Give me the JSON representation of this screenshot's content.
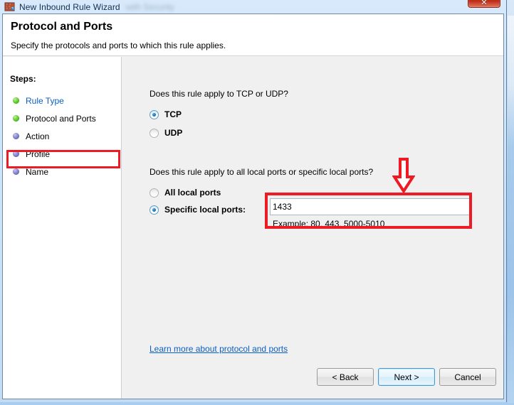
{
  "window": {
    "title": "New Inbound Rule Wizard",
    "title_blurred": "with Security",
    "icon": "firewall-icon",
    "close_label": "✕"
  },
  "header": {
    "title": "Protocol and Ports",
    "subtitle": "Specify the protocols and ports to which this rule applies."
  },
  "sidebar": {
    "steps_label": "Steps:",
    "items": [
      {
        "label": "Rule Type",
        "state": "done",
        "link": true
      },
      {
        "label": "Protocol and Ports",
        "state": "current",
        "link": false
      },
      {
        "label": "Action",
        "state": "todo",
        "link": false
      },
      {
        "label": "Profile",
        "state": "todo",
        "link": false
      },
      {
        "label": "Name",
        "state": "todo",
        "link": false
      }
    ]
  },
  "main": {
    "question_protocol": "Does this rule apply to TCP or UDP?",
    "radio_tcp": "TCP",
    "radio_udp": "UDP",
    "question_ports": "Does this rule apply to all local ports or specific local ports?",
    "radio_all_ports": "All local ports",
    "radio_specific_ports": "Specific local ports:",
    "port_value": "1433",
    "port_placeholder": "",
    "port_example": "Example: 80, 443, 5000-5010",
    "learn_more": "Learn more about protocol and ports"
  },
  "footer": {
    "back_label": "< Back",
    "next_label": "Next >",
    "cancel_label": "Cancel"
  },
  "annotations": {
    "color": "#ed1c24",
    "arrow": "down-arrow",
    "highlight_step": "Protocol and Ports",
    "highlight_field": "Specific local ports input"
  }
}
